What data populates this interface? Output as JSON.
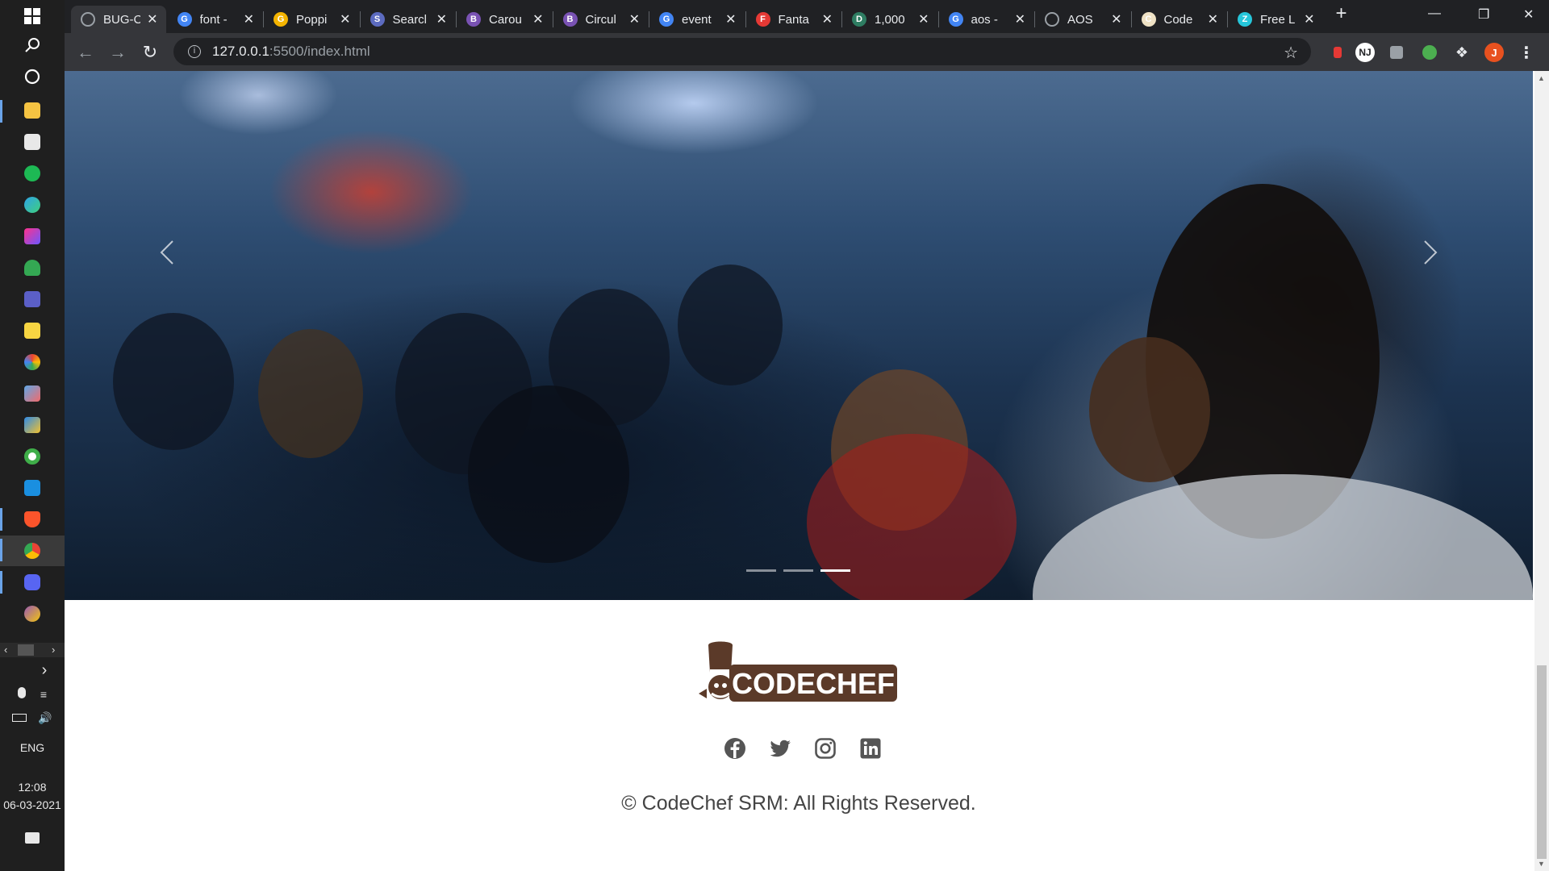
{
  "taskbar": {
    "apps": [
      {
        "name": "windows-start-icon",
        "color": "#ffffff"
      },
      {
        "name": "search-icon",
        "color": "#ffffff"
      },
      {
        "name": "cortana-icon",
        "color": "#ffffff"
      },
      {
        "name": "file-explorer-icon",
        "color": "#f5c342"
      },
      {
        "name": "store-icon",
        "color": "#ffffff"
      },
      {
        "name": "spotify-icon",
        "color": "#1db954"
      },
      {
        "name": "edge-icon",
        "color": "#2ea4e8"
      },
      {
        "name": "intellij-icon",
        "color": "#c2288a"
      },
      {
        "name": "maps-icon",
        "color": "#34a853"
      },
      {
        "name": "teams-icon",
        "color": "#5b5fc7"
      },
      {
        "name": "sticky-notes-icon",
        "color": "#f7d542"
      },
      {
        "name": "photos-icon",
        "color": "#e8eaed"
      },
      {
        "name": "paint-icon",
        "color": "#5fa8e8"
      },
      {
        "name": "files-icon",
        "color": "#f2c12e"
      },
      {
        "name": "security-icon",
        "color": "#3fae49"
      },
      {
        "name": "mail-icon",
        "color": "#1a8fe0"
      },
      {
        "name": "brave-icon",
        "color": "#fb542b"
      },
      {
        "name": "chrome-icon",
        "color": "#fbbc05"
      },
      {
        "name": "discord-icon",
        "color": "#5865f2"
      },
      {
        "name": "github-icon",
        "color": "#9b59b6"
      }
    ],
    "language": "ENG",
    "time": "12:08",
    "date": "06-03-2021"
  },
  "browser": {
    "tabs": [
      {
        "title": "BUG-C",
        "favicon": "globe",
        "color": "#9aa0a6",
        "active": true
      },
      {
        "title": "font -",
        "favicon": "G",
        "color": "#4285f4"
      },
      {
        "title": "Poppi",
        "favicon": "G",
        "color": "#f4b400"
      },
      {
        "title": "Searcl",
        "favicon": "S",
        "color": "#5c6bc0"
      },
      {
        "title": "Carou",
        "favicon": "B",
        "color": "#7952b3"
      },
      {
        "title": "Circul",
        "favicon": "B",
        "color": "#7952b3"
      },
      {
        "title": "event",
        "favicon": "G",
        "color": "#4285f4"
      },
      {
        "title": "Fanta",
        "favicon": "F",
        "color": "#e53935"
      },
      {
        "title": "1,000",
        "favicon": "D",
        "color": "#2e7d62"
      },
      {
        "title": "aos -",
        "favicon": "G",
        "color": "#4285f4"
      },
      {
        "title": "AOS",
        "favicon": "globe",
        "color": "#9aa0a6"
      },
      {
        "title": "Code",
        "favicon": "C",
        "color": "#efe2c5"
      },
      {
        "title": "Free L",
        "favicon": "Z",
        "color": "#26c6da"
      }
    ],
    "url_host": "127.0.0.1",
    "url_rest": ":5500/index.html",
    "profile_initial": "J",
    "ext_initial": "NJ"
  },
  "carousel": {
    "slide_count": 3,
    "active_index": 2
  },
  "footer": {
    "logo_text": "CODECHEF",
    "socials": [
      "facebook-icon",
      "twitter-icon",
      "instagram-icon",
      "linkedin-icon"
    ],
    "copyright": "© CodeChef SRM: All Rights Reserved."
  }
}
